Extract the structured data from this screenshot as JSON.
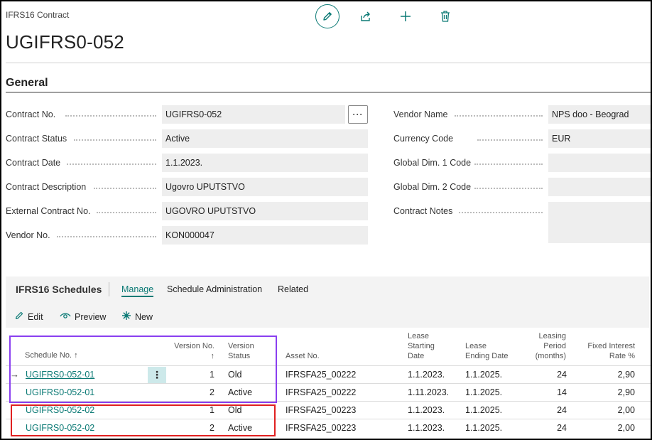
{
  "header": {
    "page_label": "IFRS16 Contract",
    "title": "UGIFRS0-052",
    "icons": [
      "pencil-icon",
      "share-icon",
      "plus-icon",
      "trash-icon"
    ]
  },
  "general": {
    "section_title": "General",
    "ellipsis": "···",
    "left_fields": [
      {
        "label": "Contract No.",
        "value": "UGIFRS0-052"
      },
      {
        "label": "Contract Status",
        "value": "Active"
      },
      {
        "label": "Contract Date",
        "value": "1.1.2023."
      },
      {
        "label": "Contract Description",
        "value": "Ugovro UPUTSTVO"
      },
      {
        "label": "External Contract No.",
        "value": "UGOVRO UPUTSTVO"
      },
      {
        "label": "Vendor No.",
        "value": "KON000047"
      }
    ],
    "right_fields": [
      {
        "label": "Vendor Name",
        "value": "NPS doo - Beograd"
      },
      {
        "label": "Currency Code",
        "value": "EUR"
      },
      {
        "label": "Global Dim. 1 Code",
        "value": ""
      },
      {
        "label": "Global Dim. 2 Code",
        "value": ""
      },
      {
        "label": "Contract Notes",
        "value": ""
      }
    ]
  },
  "schedules": {
    "title": "IFRS16 Schedules",
    "tabs": [
      "Manage",
      "Schedule Administration",
      "Related"
    ],
    "actions": [
      {
        "icon": "pencil-icon",
        "label": "Edit"
      },
      {
        "icon": "eye-icon",
        "label": "Preview"
      },
      {
        "icon": "sparkle-icon",
        "label": "New"
      }
    ],
    "columns": {
      "schedule_no": "Schedule No. ↑",
      "version_no_1": "Version No.",
      "version_no_2": "↑",
      "version_status_1": "Version",
      "version_status_2": "Status",
      "asset_no": "Asset No.",
      "lease_start_1": "Lease",
      "lease_start_2": "Starting",
      "lease_start_3": "Date",
      "lease_end_1": "Lease",
      "lease_end_2": "Ending Date",
      "leasing_period_1": "Leasing",
      "leasing_period_2": "Period",
      "leasing_period_3": "(months)",
      "fixed_rate_1": "Fixed Interest",
      "fixed_rate_2": "Rate %"
    },
    "rows": [
      {
        "schedule_no": "UGIFRS0-052-01",
        "version_no": "1",
        "version_status": "Old",
        "asset_no": "IFRSFA25_00222",
        "lease_start": "1.1.2023.",
        "lease_end": "1.1.2025.",
        "period": "24",
        "rate": "2,90"
      },
      {
        "schedule_no": "UGIFRS0-052-01",
        "version_no": "2",
        "version_status": "Active",
        "asset_no": "IFRSFA25_00222",
        "lease_start": "1.11.2023.",
        "lease_end": "1.1.2025.",
        "period": "14",
        "rate": "2,90"
      },
      {
        "schedule_no": "UGIFRS0-052-02",
        "version_no": "1",
        "version_status": "Old",
        "asset_no": "IFRSFA25_00223",
        "lease_start": "1.1.2023.",
        "lease_end": "1.1.2025.",
        "period": "24",
        "rate": "2,00"
      },
      {
        "schedule_no": "UGIFRS0-052-02",
        "version_no": "2",
        "version_status": "Active",
        "asset_no": "IFRSFA25_00223",
        "lease_start": "1.1.2023.",
        "lease_end": "1.1.2025.",
        "period": "24",
        "rate": "2,00"
      }
    ]
  },
  "colors": {
    "accent": "#0b7a75",
    "highlight_purple": "#8a3ff0",
    "highlight_red": "#e02020"
  }
}
